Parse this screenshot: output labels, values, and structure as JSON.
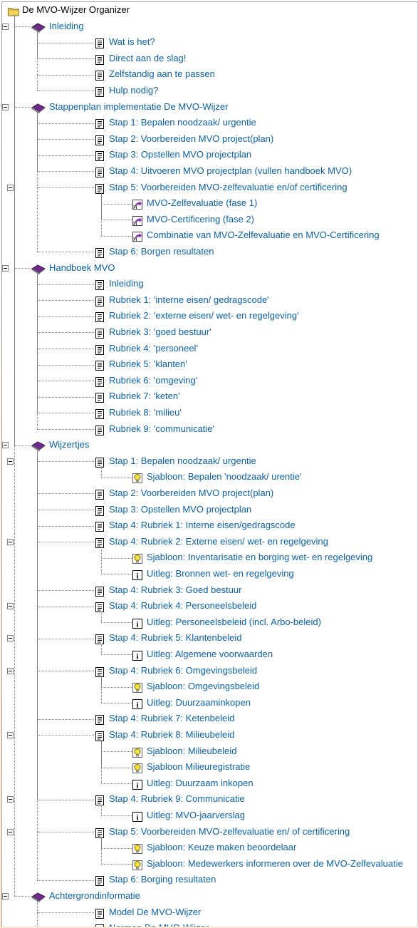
{
  "tree": {
    "rows": [
      {
        "level": 0,
        "icon": "folder",
        "label": "De MVO-Wijzer Organizer"
      },
      {
        "level": 1,
        "icon": "book",
        "label": "Inleiding",
        "expanded": true
      },
      {
        "level": 2,
        "icon": "doc",
        "label": "Wat is het?"
      },
      {
        "level": 2,
        "icon": "doc",
        "label": "Direct aan de slag!"
      },
      {
        "level": 2,
        "icon": "doc",
        "label": "Zelfstandig aan te passen"
      },
      {
        "level": 2,
        "icon": "doc",
        "label": "Hulp nodig?"
      },
      {
        "level": 1,
        "icon": "book",
        "label": "Stappenplan implementatie De MVO-Wijzer",
        "expanded": true
      },
      {
        "level": 2,
        "icon": "doc",
        "label": "Stap 1: Bepalen noodzaak/ urgentie"
      },
      {
        "level": 2,
        "icon": "doc",
        "label": "Stap 2: Voorbereiden MVO project(plan)"
      },
      {
        "level": 2,
        "icon": "doc",
        "label": "Stap 3: Opstellen MVO projectplan"
      },
      {
        "level": 2,
        "icon": "doc",
        "label": "Stap 4: Uitvoeren MVO projectplan (vullen handboek MVO)"
      },
      {
        "level": 2,
        "icon": "doc",
        "label": "Stap 5: Voorbereiden MVO-zelfevaluatie en/of certificering",
        "expanded": true
      },
      {
        "level": 3,
        "icon": "shortcut",
        "label": "MVO-Zelfevaluatie (fase 1)"
      },
      {
        "level": 3,
        "icon": "shortcut",
        "label": "MVO-Certificering (fase 2)"
      },
      {
        "level": 3,
        "icon": "shortcut",
        "label": "Combinatie van MVO-Zelfevaluatie en MVO-Certificering"
      },
      {
        "level": 2,
        "icon": "doc",
        "label": "Stap 6: Borgen resultaten"
      },
      {
        "level": 1,
        "icon": "book",
        "label": "Handboek MVO",
        "expanded": true
      },
      {
        "level": 2,
        "icon": "doc",
        "label": "Inleiding"
      },
      {
        "level": 2,
        "icon": "doc",
        "label": "Rubriek 1: 'interne eisen/ gedragscode'"
      },
      {
        "level": 2,
        "icon": "doc",
        "label": "Rubriek 2: 'externe eisen/ wet- en regelgeving'"
      },
      {
        "level": 2,
        "icon": "doc",
        "label": "Rubriek 3: 'goed bestuur'"
      },
      {
        "level": 2,
        "icon": "doc",
        "label": "Rubriek 4: 'personeel'"
      },
      {
        "level": 2,
        "icon": "doc",
        "label": "Rubriek 5: 'klanten'"
      },
      {
        "level": 2,
        "icon": "doc",
        "label": "Rubriek 6: 'omgeving'"
      },
      {
        "level": 2,
        "icon": "doc",
        "label": "Rubriek 7: 'keten'"
      },
      {
        "level": 2,
        "icon": "doc",
        "label": "Rubriek 8: 'milieu'"
      },
      {
        "level": 2,
        "icon": "doc",
        "label": "Rubriek 9: 'communicatie'"
      },
      {
        "level": 1,
        "icon": "book",
        "label": "Wijzertjes",
        "expanded": true
      },
      {
        "level": 2,
        "icon": "doc",
        "label": "Stap 1: Bepalen noodzaak/ urgentie",
        "expanded": true
      },
      {
        "level": 3,
        "icon": "bulb",
        "label": "Sjabloon: Bepalen 'noodzaak/ urentie'"
      },
      {
        "level": 2,
        "icon": "doc",
        "label": "Stap 2: Voorbereiden MVO project(plan)"
      },
      {
        "level": 2,
        "icon": "doc",
        "label": "Stap 3: Opstellen MVO projectplan"
      },
      {
        "level": 2,
        "icon": "doc",
        "label": "Stap 4: Rubriek 1: Interne eisen/gedragscode"
      },
      {
        "level": 2,
        "icon": "doc",
        "label": "Stap 4: Rubriek 2: Externe eisen/ wet- en regelgeving",
        "expanded": true
      },
      {
        "level": 3,
        "icon": "bulb",
        "label": "Sjabloon: Inventarisatie en borging wet- en regelgeving"
      },
      {
        "level": 3,
        "icon": "info",
        "label": "Uitleg: Bronnen wet- en regelgeving"
      },
      {
        "level": 2,
        "icon": "doc",
        "label": "Stap 4: Rubriek 3: Goed bestuur"
      },
      {
        "level": 2,
        "icon": "doc",
        "label": "Stap 4: Rubriek 4: Personeelsbeleid",
        "expanded": true
      },
      {
        "level": 3,
        "icon": "info",
        "label": "Uitleg: Personeelsbeleid (incl. Arbo-beleid)"
      },
      {
        "level": 2,
        "icon": "doc",
        "label": "Stap 4: Rubriek 5: Klantenbeleid",
        "expanded": true
      },
      {
        "level": 3,
        "icon": "info",
        "label": "Uitleg: Algemene voorwaarden"
      },
      {
        "level": 2,
        "icon": "doc",
        "label": "Stap 4: Rubriek 6: Omgevingsbeleid",
        "expanded": true
      },
      {
        "level": 3,
        "icon": "bulb",
        "label": "Sjabloon: Omgevingsbeleid"
      },
      {
        "level": 3,
        "icon": "info",
        "label": "Uitleg: Duurzaaminkopen"
      },
      {
        "level": 2,
        "icon": "doc",
        "label": "Stap 4: Rubriek 7: Ketenbeleid"
      },
      {
        "level": 2,
        "icon": "doc",
        "label": "Stap 4: Rubriek 8: Milieubeleid",
        "expanded": true
      },
      {
        "level": 3,
        "icon": "bulb",
        "label": "Sjabloon: Milieubeleid"
      },
      {
        "level": 3,
        "icon": "bulb",
        "label": "Sjabloon Milieuregistratie"
      },
      {
        "level": 3,
        "icon": "info",
        "label": "Uitleg: Duurzaam inkopen"
      },
      {
        "level": 2,
        "icon": "doc",
        "label": "Stap 4: Rubriek 9: Communicatie",
        "expanded": true
      },
      {
        "level": 3,
        "icon": "info",
        "label": "Uitleg: MVO-jaarverslag"
      },
      {
        "level": 2,
        "icon": "doc",
        "label": "Stap 5: Voorbereiden MVO-zelfevaluatie en/ of certificering",
        "expanded": true
      },
      {
        "level": 3,
        "icon": "bulb",
        "label": "Sjabloon: Keuze maken beoordelaar"
      },
      {
        "level": 3,
        "icon": "bulb",
        "label": "Sjabloon: Medewerkers informeren over de MVO-Zelfevaluatie"
      },
      {
        "level": 2,
        "icon": "doc",
        "label": "Stap 6: Borging resultaten"
      },
      {
        "level": 1,
        "icon": "book",
        "label": "Achtergrondinformatie",
        "expanded": true
      },
      {
        "level": 2,
        "icon": "doc",
        "label": "Model De MVO-Wijzer"
      },
      {
        "level": 2,
        "icon": "doc",
        "label": "Normen De MVO-Wijzer"
      }
    ]
  },
  "colors": {
    "node_text": "#0a61a8",
    "root_text": "#000000",
    "tree_lines": "#808080",
    "book_icon": "#6d2b8c",
    "folder_icon": "#f2d35c",
    "shortcut_icon": "#8a2fb8",
    "bulb_icon": "#f2e23a"
  }
}
